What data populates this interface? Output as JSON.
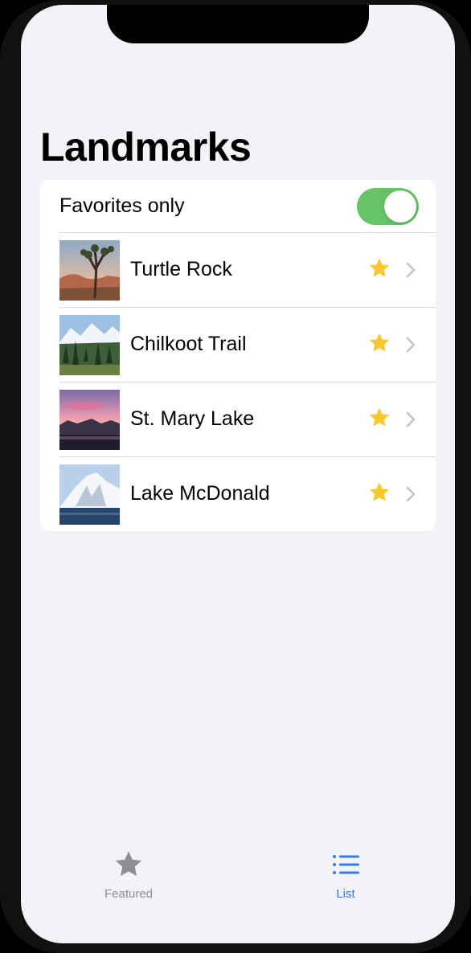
{
  "nav": {
    "title": "Landmarks"
  },
  "favorites_toggle": {
    "label": "Favorites only",
    "on": true
  },
  "landmarks": [
    {
      "name": "Turtle Rock",
      "favorite": true
    },
    {
      "name": "Chilkoot Trail",
      "favorite": true
    },
    {
      "name": "St. Mary Lake",
      "favorite": true
    },
    {
      "name": "Lake McDonald",
      "favorite": true
    }
  ],
  "tabs": [
    {
      "label": "Featured",
      "icon": "star-icon",
      "selected": false
    },
    {
      "label": "List",
      "icon": "list-icon",
      "selected": true
    }
  ],
  "colors": {
    "accent": "#2f7cf6",
    "toggle_on": "#65c466",
    "star": "#f6c82e",
    "tab_inactive": "#8e8e93",
    "background": "#f2f2f7"
  }
}
